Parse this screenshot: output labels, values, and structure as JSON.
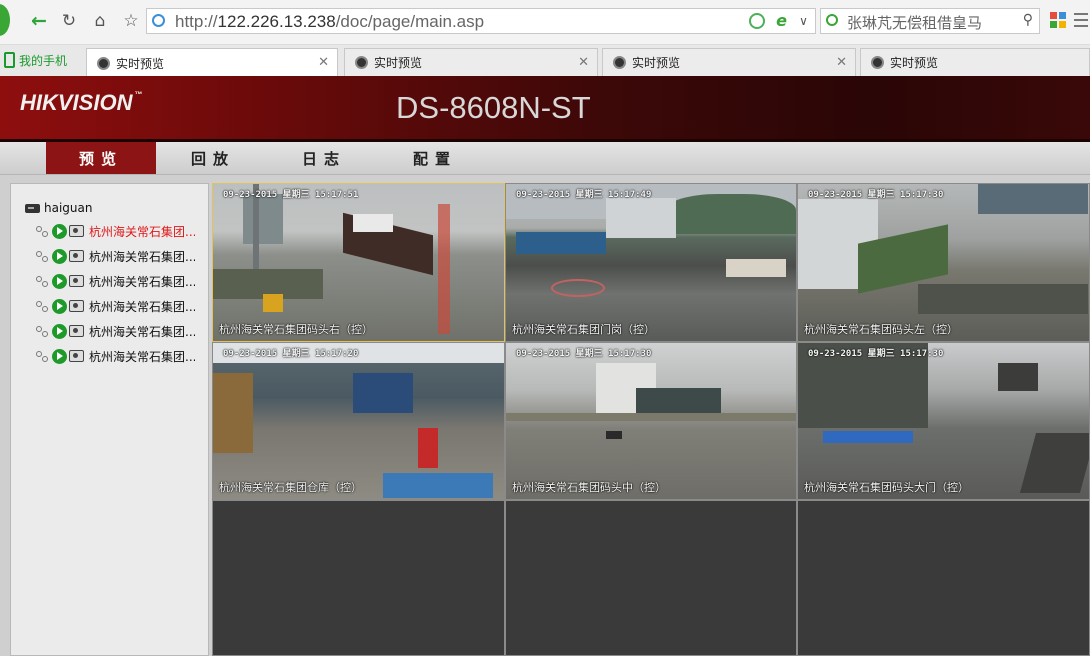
{
  "browser": {
    "url_protocol": "http://",
    "url_host": "122.226.13.238",
    "url_path": "/doc/page/main.asp",
    "search_text": "张琳芃无偿租借皇马",
    "phone_tab_label": "我的手机",
    "tabs": [
      {
        "label": "实时预览",
        "active": true
      },
      {
        "label": "实时预览",
        "active": false
      },
      {
        "label": "实时预览",
        "active": false
      },
      {
        "label": "实时预览",
        "active": false
      }
    ]
  },
  "header": {
    "logo": "HIKVISION",
    "model": "DS-8608N-ST",
    "brand_color": "#8c1414"
  },
  "menu": [
    {
      "label": "预览",
      "active": true
    },
    {
      "label": "回放",
      "active": false
    },
    {
      "label": "日志",
      "active": false
    },
    {
      "label": "配置",
      "active": false
    }
  ],
  "device_tree": {
    "device_name": "haiguan",
    "channels": [
      {
        "label": "杭州海关常石集团...",
        "selected": true
      },
      {
        "label": "杭州海关常石集团...",
        "selected": false
      },
      {
        "label": "杭州海关常石集团...",
        "selected": false
      },
      {
        "label": "杭州海关常石集团...",
        "selected": false
      },
      {
        "label": "杭州海关常石集团...",
        "selected": false
      },
      {
        "label": "杭州海关常石集团...",
        "selected": false
      }
    ]
  },
  "video_cells": [
    {
      "time": "09-23-2015 星期三 15:17:51",
      "name": "杭州海关常石集团码头右（控）"
    },
    {
      "time": "09-23-2015 星期三 15:17:49",
      "name": "杭州海关常石集团门岗（控）"
    },
    {
      "time": "09-23-2015 星期三 15:17:30",
      "name": "杭州海关常石集团码头左（控）"
    },
    {
      "time": "09-23-2015 星期三 15:17:20",
      "name": "杭州海关常石集团仓库（控）"
    },
    {
      "time": "09-23-2015 星期三 15:17:30",
      "name": "杭州海关常石集团码头中（控）"
    },
    {
      "time": "09-23-2015 星期三 15:17:30",
      "name": "杭州海关常石集团码头大门（控）"
    }
  ]
}
